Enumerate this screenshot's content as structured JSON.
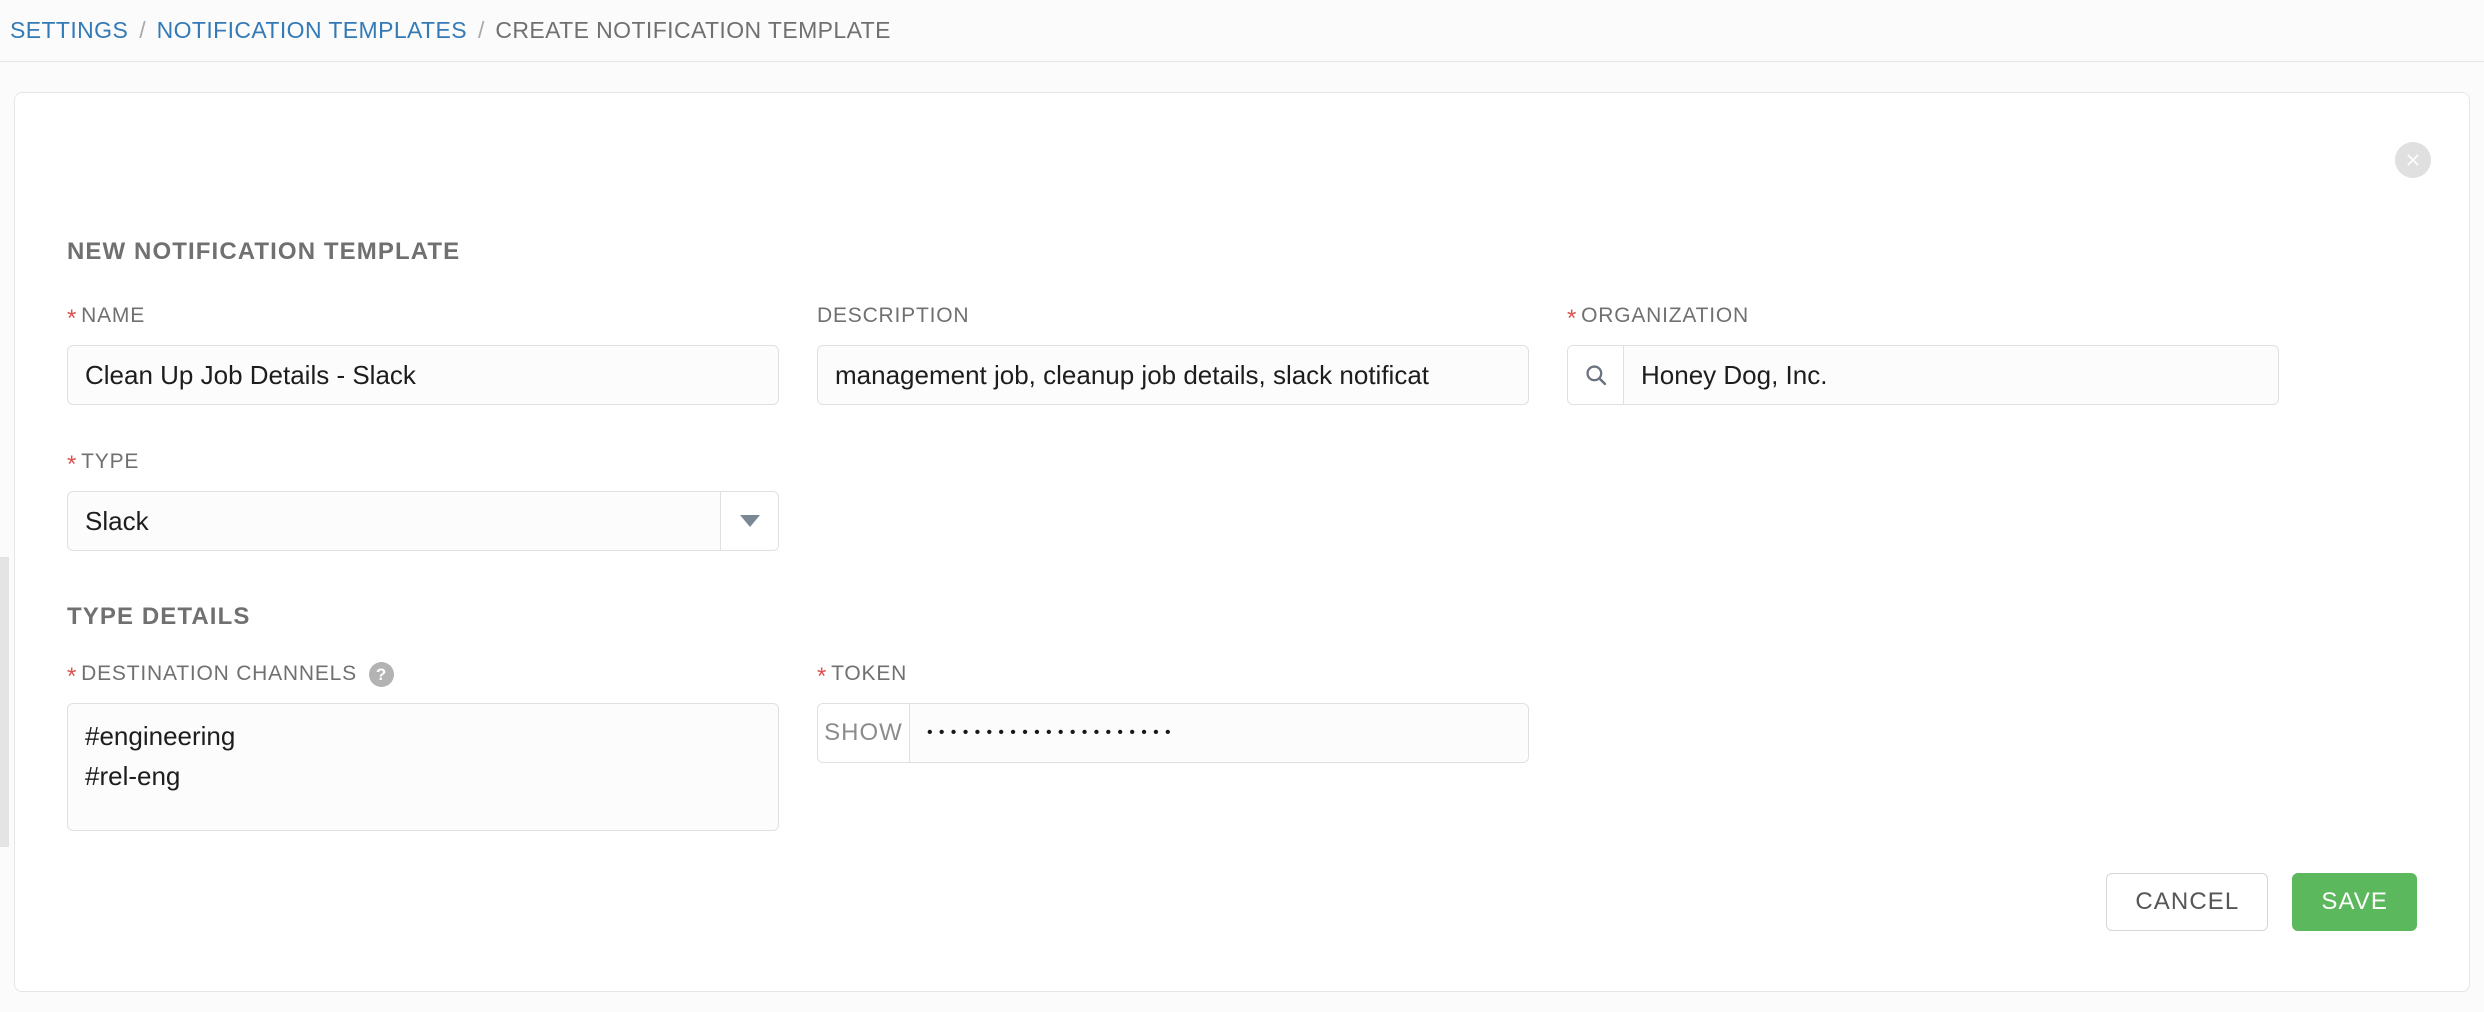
{
  "breadcrumb": {
    "items": [
      {
        "label": "SETTINGS",
        "current": false
      },
      {
        "label": "NOTIFICATION TEMPLATES",
        "current": false
      },
      {
        "label": "CREATE NOTIFICATION TEMPLATE",
        "current": true
      }
    ],
    "separator": "/"
  },
  "card": {
    "title": "NEW NOTIFICATION TEMPLATE",
    "close_icon": "close-circle-icon"
  },
  "form": {
    "name": {
      "label": "NAME",
      "required_marker": "*",
      "value": "Clean Up Job Details - Slack"
    },
    "description": {
      "label": "DESCRIPTION",
      "value": "management job, cleanup job details, slack notificat"
    },
    "organization": {
      "label": "ORGANIZATION",
      "required_marker": "*",
      "value": "Honey Dog, Inc.",
      "lookup_icon": "search-icon"
    },
    "type": {
      "label": "TYPE",
      "required_marker": "*",
      "value": "Slack",
      "caret_icon": "chevron-down-icon"
    }
  },
  "type_details": {
    "heading": "TYPE DETAILS",
    "destination_channels": {
      "label": "DESTINATION CHANNELS",
      "required_marker": "*",
      "help_icon": "question-mark-icon",
      "value": "#engineering\n#rel-eng"
    },
    "token": {
      "label": "TOKEN",
      "required_marker": "*",
      "show_button_label": "SHOW",
      "masked_value": "•••••••••••••••••••••"
    }
  },
  "footer": {
    "cancel_label": "CANCEL",
    "save_label": "SAVE"
  },
  "colors": {
    "link": "#337ab7",
    "required": "#d9534f",
    "save": "#5cb85c",
    "muted_text": "#707070"
  }
}
